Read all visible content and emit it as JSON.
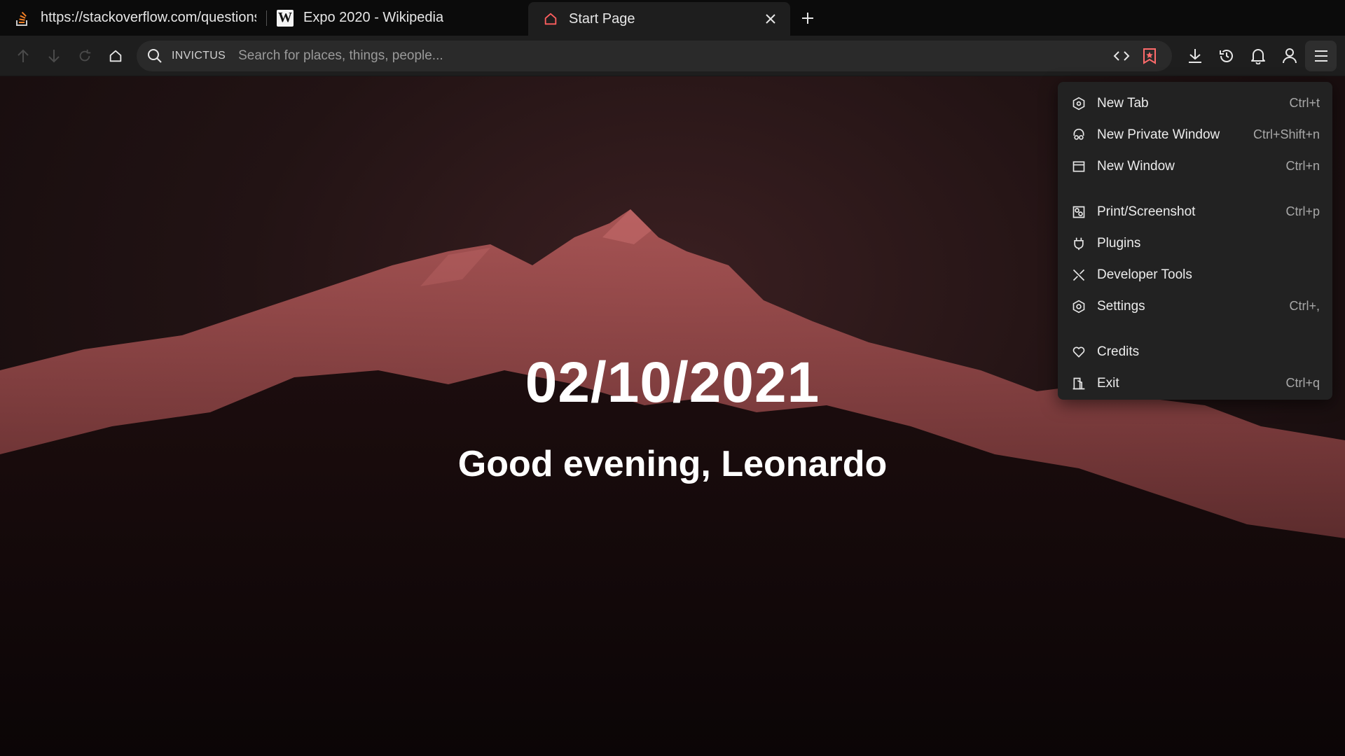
{
  "tabs": [
    {
      "title": "https://stackoverflow.com/questions",
      "icon": "stackoverflow-icon",
      "active": false
    },
    {
      "title": "Expo 2020 - Wikipedia",
      "icon": "wikipedia-icon",
      "favicon_text": "W",
      "active": false
    },
    {
      "title": "Start Page",
      "icon": "home-icon",
      "active": true
    }
  ],
  "toolbar": {
    "search_engine": "INVICTUS",
    "search_placeholder": "Search for places, things, people..."
  },
  "start_page": {
    "date": "02/10/2021",
    "greeting": "Good evening, Leonardo"
  },
  "menu": {
    "items": [
      {
        "label": "New Tab",
        "shortcut": "Ctrl+t",
        "icon": "new-tab-icon"
      },
      {
        "label": "New Private Window",
        "shortcut": "Ctrl+Shift+n",
        "icon": "private-window-icon"
      },
      {
        "label": "New Window",
        "shortcut": "Ctrl+n",
        "icon": "window-icon"
      },
      {
        "label": "Print/Screenshot",
        "shortcut": "Ctrl+p",
        "icon": "print-icon"
      },
      {
        "label": "Plugins",
        "shortcut": "",
        "icon": "plugin-icon"
      },
      {
        "label": "Developer Tools",
        "shortcut": "",
        "icon": "tools-icon"
      },
      {
        "label": "Settings",
        "shortcut": "Ctrl+,",
        "icon": "settings-icon"
      },
      {
        "label": "Credits",
        "shortcut": "",
        "icon": "credits-icon"
      },
      {
        "label": "Exit",
        "shortcut": "Ctrl+q",
        "icon": "exit-icon"
      }
    ]
  },
  "colors": {
    "accent": "#ff6b6b",
    "tabstrip": "#0b0b0b",
    "toolbar": "#1e1e1e",
    "menu": "#222222"
  }
}
